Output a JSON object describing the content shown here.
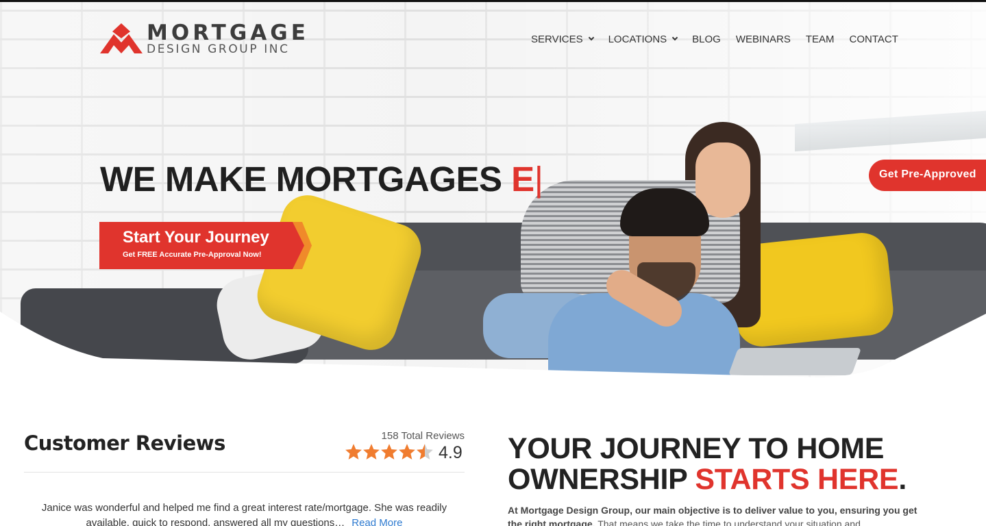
{
  "brand": {
    "name_line1": "MORTGAGE",
    "name_line2": "DESIGN GROUP INC",
    "accent": "#e0342d"
  },
  "nav": {
    "items": [
      {
        "label": "SERVICES",
        "has_dropdown": true
      },
      {
        "label": "LOCATIONS",
        "has_dropdown": true
      },
      {
        "label": "BLOG",
        "has_dropdown": false
      },
      {
        "label": "WEBINARS",
        "has_dropdown": false
      },
      {
        "label": "TEAM",
        "has_dropdown": false
      },
      {
        "label": "CONTACT",
        "has_dropdown": false
      }
    ]
  },
  "hero": {
    "headline": "WE MAKE MORTGAGES",
    "typed_text": "E",
    "cursor": "|",
    "cta_title": "Start Your Journey",
    "cta_subtitle": "Get FREE Accurate Pre-Approval Now!",
    "side_button": "Get Pre-Approved"
  },
  "reviews": {
    "title": "Customer Reviews",
    "total": "158 Total Reviews",
    "rating": "4.9",
    "star_rating": 4.5,
    "star_color": "#f07c2f",
    "review_text": "Janice was wonderful and helped me find a great interest rate/mortgage. She was readily available, quick to respond, answered all my questions…",
    "read_more": "Read More"
  },
  "journey": {
    "title_part1": "YOUR JOURNEY TO HOME",
    "title_part2": "OWNERSHIP",
    "title_highlight": "STARTS HERE",
    "title_end": ".",
    "desc_bold": "At Mortgage Design Group, our main objective is to deliver value to you, ensuring you get the right mortgage.",
    "desc_rest": "That means we take the time to understand your situation and"
  }
}
